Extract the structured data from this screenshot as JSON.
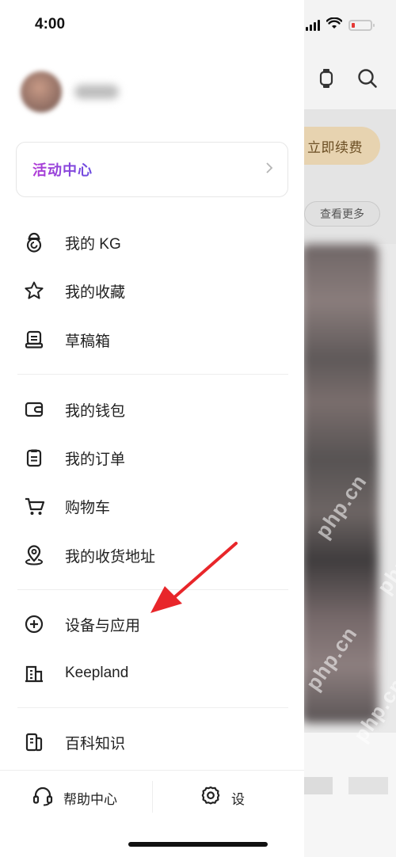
{
  "status_bar": {
    "time": "4:00"
  },
  "user": {
    "name": ""
  },
  "activity_card": {
    "label": "活动中心"
  },
  "menu": {
    "group1": [
      {
        "label": "我的 KG",
        "icon": "kettlebell-icon"
      },
      {
        "label": "我的收藏",
        "icon": "star-icon"
      },
      {
        "label": "草稿箱",
        "icon": "draft-box-icon"
      }
    ],
    "group2": [
      {
        "label": "我的钱包",
        "icon": "wallet-icon"
      },
      {
        "label": "我的订单",
        "icon": "clipboard-icon"
      },
      {
        "label": "购物车",
        "icon": "cart-icon"
      },
      {
        "label": "我的收货地址",
        "icon": "location-pin-icon"
      }
    ],
    "group3": [
      {
        "label": "设备与应用",
        "icon": "plus-circle-icon"
      },
      {
        "label": "Keepland",
        "icon": "building-icon"
      }
    ],
    "group4": [
      {
        "label": "百科知识",
        "icon": "encyclopedia-icon"
      }
    ]
  },
  "bottom_bar": {
    "help_label": "帮助中心",
    "settings_label": "设"
  },
  "background_app": {
    "renew_label": "立即续费",
    "more_label": "查看更多"
  },
  "watermark": {
    "text": "php.cn"
  },
  "colors": {
    "annotation_arrow": "#e8262a",
    "activity_gradient": [
      "#b23bd6",
      "#6a4de0"
    ],
    "renew_button": "#e7d3b0"
  }
}
